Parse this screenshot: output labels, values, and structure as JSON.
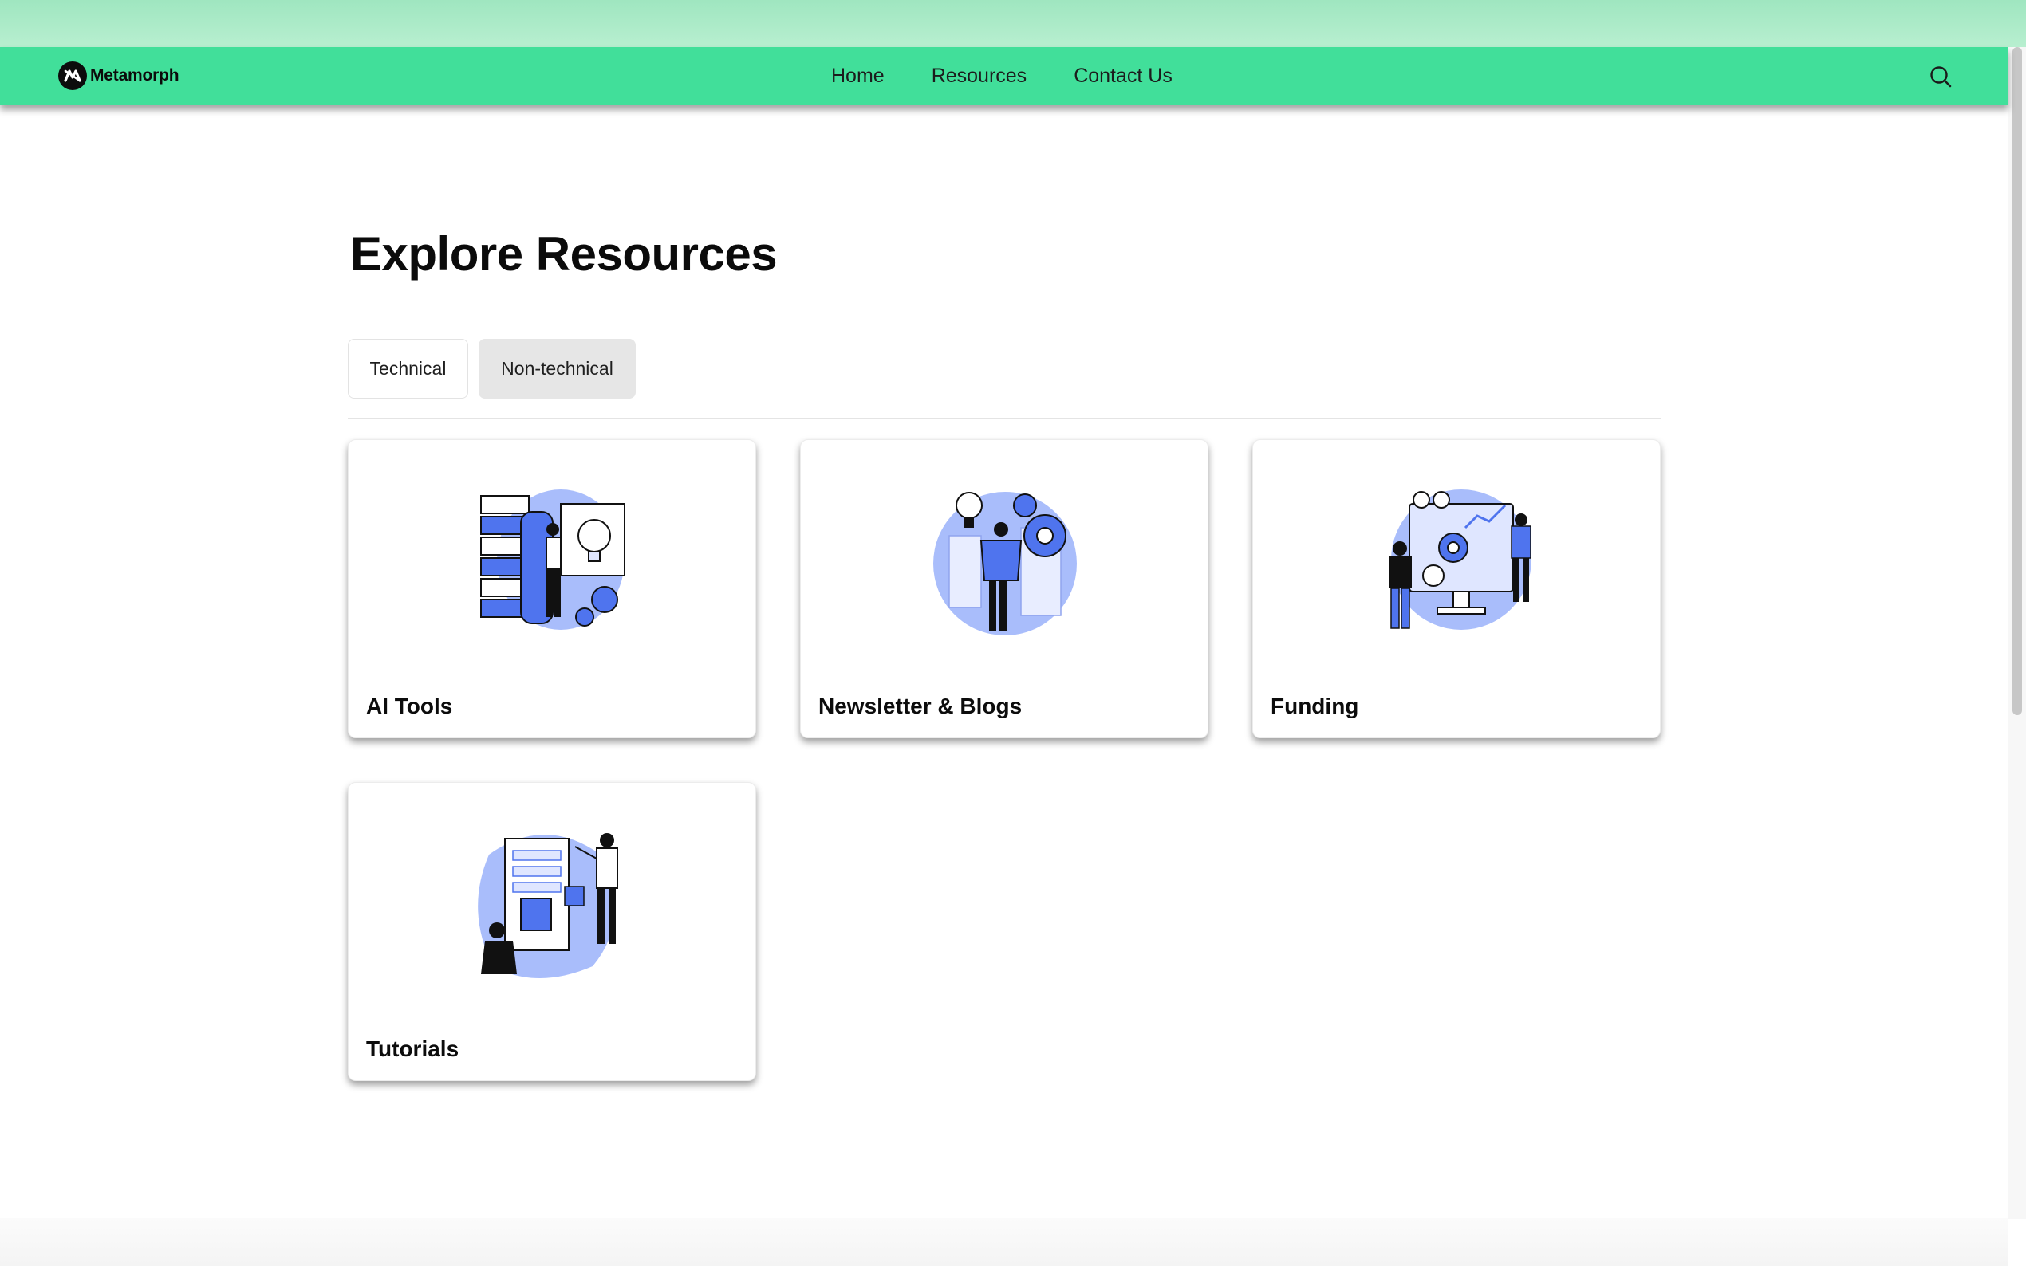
{
  "brand": {
    "name": "Metamorph"
  },
  "nav": {
    "links": [
      "Home",
      "Resources",
      "Contact Us"
    ],
    "search_icon": "search-icon"
  },
  "main": {
    "title": "Explore Resources",
    "tabs": [
      {
        "label": "Technical",
        "selected": false
      },
      {
        "label": "Non-technical",
        "selected": true
      }
    ],
    "cards": [
      {
        "title": "AI Tools",
        "illustration": "server-lightbulb-illustration"
      },
      {
        "title": "Newsletter & Blogs",
        "illustration": "gears-lightbulb-illustration"
      },
      {
        "title": "Funding",
        "illustration": "team-dashboard-illustration"
      },
      {
        "title": "Tutorials",
        "illustration": "people-board-illustration"
      }
    ]
  },
  "colors": {
    "navbar": "#41df9a",
    "accent_illustration": "#4f74ee",
    "illustration_blob": "#a9bdfb"
  }
}
